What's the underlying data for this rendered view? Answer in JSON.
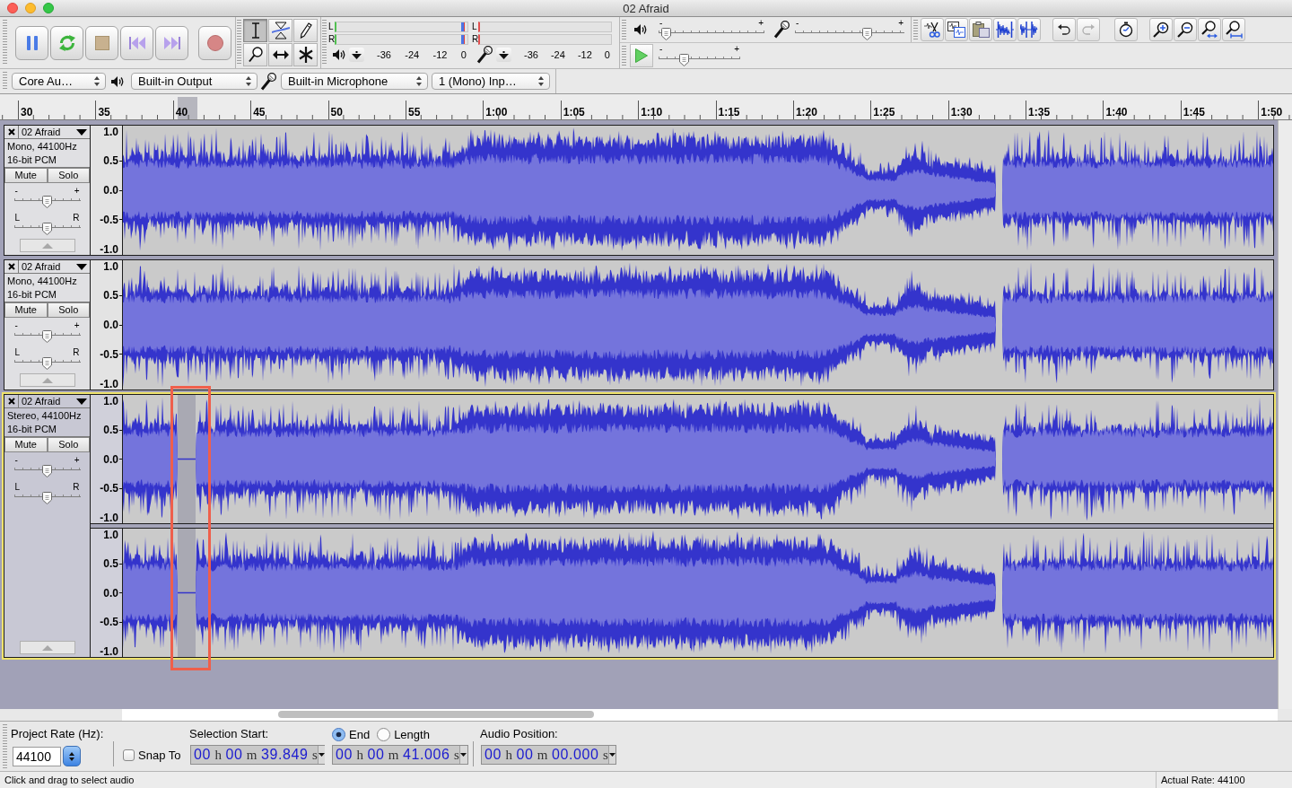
{
  "window": {
    "title": "02 Afraid"
  },
  "transport": [
    {
      "kind": "pause"
    },
    {
      "kind": "loop"
    },
    {
      "kind": "stop"
    },
    {
      "kind": "skip_start"
    },
    {
      "kind": "skip_end"
    },
    {
      "kind": "record"
    }
  ],
  "tools": [
    {
      "kind": "select",
      "selected": true
    },
    {
      "kind": "envelope",
      "selected": false
    },
    {
      "kind": "draw",
      "selected": false
    },
    {
      "kind": "zoom",
      "selected": false
    },
    {
      "kind": "time_shift",
      "selected": false
    },
    {
      "kind": "multi",
      "selected": false
    }
  ],
  "meters": [
    {
      "kind": "playback",
      "channels": [
        {
          "label": "L",
          "level": 0.98
        },
        {
          "label": "R",
          "level": 0.98
        }
      ],
      "scale": [
        "-36",
        "-24",
        "-12",
        "0"
      ]
    },
    {
      "kind": "recording",
      "channels": [
        {
          "label": "L"
        },
        {
          "label": "R"
        }
      ],
      "scale": [
        "-36",
        "-24",
        "-12",
        "0"
      ]
    }
  ],
  "mixer": [
    {
      "kind": "output",
      "min_label": "-",
      "max_label": "+",
      "level": 0.03
    },
    {
      "kind": "input",
      "min_label": "-",
      "max_label": "+",
      "level": 0.68
    }
  ],
  "play_at_speed": {
    "min_label": "-",
    "max_label": "+",
    "level": 0.29
  },
  "edit_buttons": [
    {
      "kind": "cut",
      "disabled": false
    },
    {
      "kind": "copy",
      "disabled": false
    },
    {
      "kind": "paste",
      "disabled": false
    },
    {
      "kind": "trim",
      "disabled": false
    },
    {
      "kind": "silence",
      "disabled": false
    },
    {
      "kind": "undo",
      "disabled": false
    },
    {
      "kind": "redo",
      "disabled": true
    },
    {
      "kind": "sync_lock",
      "disabled": false
    },
    {
      "kind": "zoom_in",
      "disabled": false
    },
    {
      "kind": "zoom_out",
      "disabled": false
    },
    {
      "kind": "fit_selection",
      "disabled": false
    },
    {
      "kind": "fit_project",
      "disabled": false
    }
  ],
  "devices": [
    {
      "kind": "host",
      "value": "Core Au…"
    },
    {
      "kind": "output",
      "value": "Built-in Output"
    },
    {
      "kind": "input",
      "value": "Built-in Microphone"
    },
    {
      "kind": "channels",
      "value": "1 (Mono) Inp…"
    }
  ],
  "ruler": {
    "labels": [
      "30",
      "35",
      "40",
      "45",
      "50",
      "55",
      "1:00",
      "1:05",
      "1:10",
      "1:15",
      "1:20",
      "1:25",
      "1:30",
      "1:35",
      "1:40",
      "1:45",
      "1:50"
    ]
  },
  "tracks": [
    {
      "name": "02 Afraid",
      "format": "Mono, 44100Hz",
      "sample_format": "16-bit PCM",
      "mute": "Mute",
      "solo": "Solo",
      "selected": false,
      "gain": {
        "min_label": "-",
        "max_label": "+",
        "level": 0.5
      },
      "pan": {
        "min_label": "L",
        "max_label": "R",
        "level": 0.5
      },
      "channels": [
        {
          "scale": [
            "1.0",
            "0.5",
            "0.0",
            "-0.5",
            "-1.0"
          ]
        }
      ]
    },
    {
      "name": "02 Afraid",
      "format": "Mono, 44100Hz",
      "sample_format": "16-bit PCM",
      "mute": "Mute",
      "solo": "Solo",
      "selected": false,
      "gain": {
        "min_label": "-",
        "max_label": "+",
        "level": 0.5
      },
      "pan": {
        "min_label": "L",
        "max_label": "R",
        "level": 0.5
      },
      "channels": [
        {
          "scale": [
            "1.0",
            "0.5",
            "0.0",
            "-0.5",
            "-1.0"
          ]
        }
      ]
    },
    {
      "name": "02 Afraid",
      "format": "Stereo, 44100Hz",
      "sample_format": "16-bit PCM",
      "mute": "Mute",
      "solo": "Solo",
      "selected": true,
      "gain": {
        "min_label": "-",
        "max_label": "+",
        "level": 0.5
      },
      "pan": {
        "min_label": "L",
        "max_label": "R",
        "level": 0.5
      },
      "channels": [
        {
          "scale": [
            "1.0",
            "0.5",
            "0.0",
            "-0.5",
            "-1.0"
          ]
        },
        {
          "scale": [
            "1.0",
            "0.5",
            "0.0",
            "-0.5",
            "-1.0"
          ]
        }
      ]
    }
  ],
  "annotation": {
    "kind": "rectangle"
  },
  "selection_bar": {
    "project_rate": {
      "label": "Project Rate (Hz):",
      "value": "44100"
    },
    "snap_to": {
      "label": "Snap To",
      "checked": false
    },
    "selection_start": {
      "label": "Selection Start:",
      "value": [
        {
          "number": "00",
          "unit": "h"
        },
        {
          "number": "00",
          "unit": "m"
        },
        {
          "number": "39.849",
          "unit": "s"
        }
      ]
    },
    "end_mode": [
      {
        "label": "End",
        "selected": true
      },
      {
        "label": "Length",
        "selected": false
      }
    ],
    "selection_end": {
      "value": [
        {
          "number": "00",
          "unit": "h"
        },
        {
          "number": "00",
          "unit": "m"
        },
        {
          "number": "41.006",
          "unit": "s"
        }
      ]
    },
    "audio_position": {
      "label": "Audio Position:",
      "value": [
        {
          "number": "00",
          "unit": "h"
        },
        {
          "number": "00",
          "unit": "m"
        },
        {
          "number": "00.000",
          "unit": "s"
        }
      ]
    }
  },
  "status_bar": {
    "message": "Click and drag to select audio",
    "rate": "Actual Rate: 44100"
  }
}
